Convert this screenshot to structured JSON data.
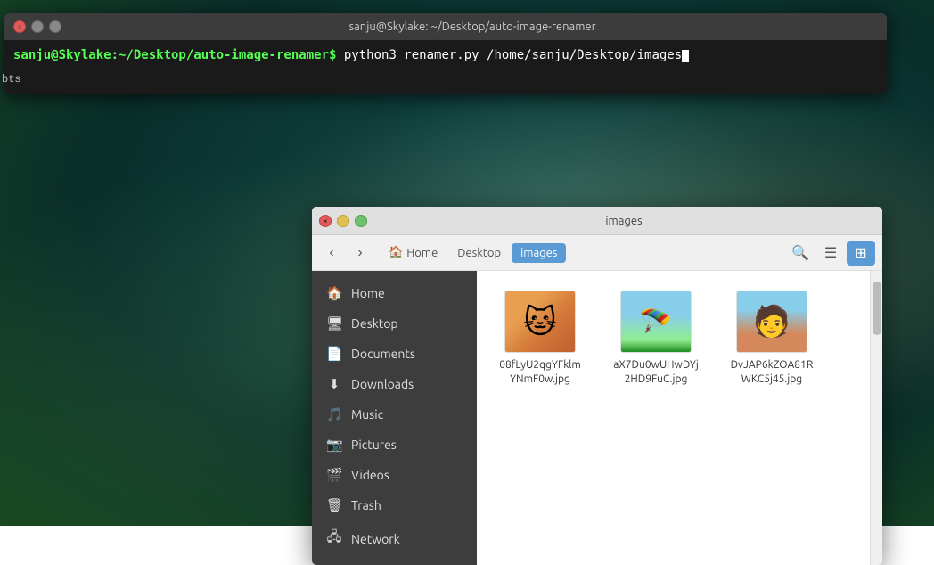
{
  "terminal": {
    "title": "sanju@Skylake: ~/Desktop/auto-image-renamer",
    "close_btn": "×",
    "prompt_text": "sanju@Skylake:~/Desktop/auto-image-renamer$",
    "command": " python3 renamer.py /home/sanju/Desktop/images",
    "side_label": "bts"
  },
  "filemanager": {
    "title": "images",
    "breadcrumb": {
      "home": "Home",
      "desktop": "Desktop",
      "images": "images"
    },
    "sidebar": {
      "items": [
        {
          "icon": "🏠",
          "label": "Home"
        },
        {
          "icon": "🖥",
          "label": "Desktop"
        },
        {
          "icon": "📄",
          "label": "Documents"
        },
        {
          "icon": "⬇",
          "label": "Downloads"
        },
        {
          "icon": "🎵",
          "label": "Music"
        },
        {
          "icon": "📷",
          "label": "Pictures"
        },
        {
          "icon": "🎬",
          "label": "Videos"
        },
        {
          "icon": "🗑",
          "label": "Trash"
        },
        {
          "icon": "🖧",
          "label": "Network"
        }
      ]
    },
    "files": [
      {
        "name": "08fLyU2qgYFklmYNmF0w.jpg",
        "thumb_type": "cat"
      },
      {
        "name": "aX7Du0wUHwDYj2HD9FuC.jpg",
        "thumb_type": "parachute"
      },
      {
        "name": "DvJAP6kZOA81RWKC5j45.jpg",
        "thumb_type": "person"
      }
    ]
  }
}
